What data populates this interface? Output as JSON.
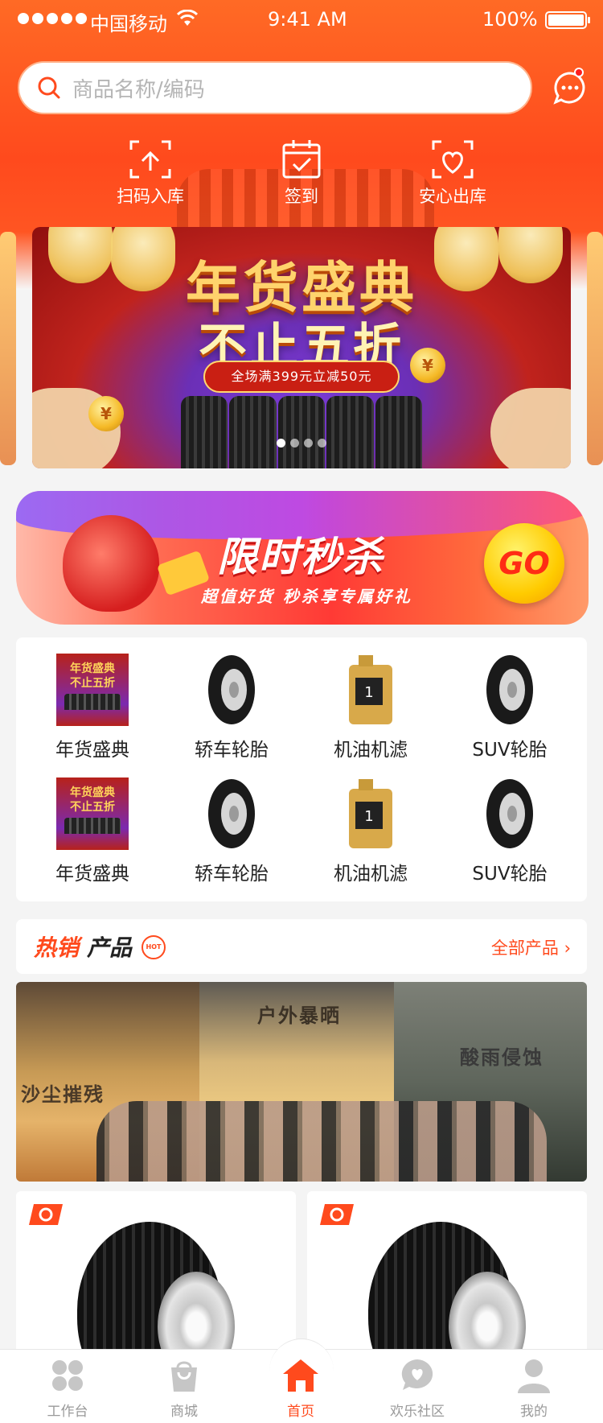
{
  "status_bar": {
    "carrier": "中国移动",
    "time": "9:41 AM",
    "battery": "100%"
  },
  "search": {
    "placeholder": "商品名称/编码"
  },
  "quick_actions": [
    {
      "label": "扫码入库",
      "icon": "scan-in-icon"
    },
    {
      "label": "签到",
      "icon": "calendar-check-icon"
    },
    {
      "label": "安心出库",
      "icon": "scan-out-icon"
    }
  ],
  "banner": {
    "title_line1": "年货盛典",
    "title_line2": "不止五折",
    "promo": "全场满399元立减50元",
    "slides": 4,
    "active_slide": 1
  },
  "flash_sale": {
    "title": "限时秒杀",
    "subtitle": "超值好货 秒杀享专属好礼",
    "go": "GO"
  },
  "categories": [
    {
      "label": "年货盛典",
      "thumb": "promo",
      "thumb_line1": "年货盛典",
      "thumb_line2": "不止五折"
    },
    {
      "label": "轿车轮胎",
      "thumb": "tyre"
    },
    {
      "label": "机油机滤",
      "thumb": "oil"
    },
    {
      "label": "SUV轮胎",
      "thumb": "tyre"
    },
    {
      "label": "年货盛典",
      "thumb": "promo",
      "thumb_line1": "年货盛典",
      "thumb_line2": "不止五折"
    },
    {
      "label": "轿车轮胎",
      "thumb": "tyre"
    },
    {
      "label": "机油机滤",
      "thumb": "oil"
    },
    {
      "label": "SUV轮胎",
      "thumb": "tyre"
    }
  ],
  "hot": {
    "title_red": "热销",
    "title_dark": "产品",
    "badge": "HOT",
    "all_link": "全部产品"
  },
  "feature": {
    "panel1": "沙尘摧残",
    "panel2": "户外暴晒",
    "panel3": "酸雨侵蚀"
  },
  "tabbar": [
    {
      "label": "工作台",
      "icon": "workbench-icon",
      "active": false
    },
    {
      "label": "商城",
      "icon": "shopping-bag-icon",
      "active": false
    },
    {
      "label": "首页",
      "icon": "home-icon",
      "active": true
    },
    {
      "label": "欢乐社区",
      "icon": "chat-heart-icon",
      "active": false
    },
    {
      "label": "我的",
      "icon": "user-icon",
      "active": false
    }
  ],
  "colors": {
    "accent": "#ff4a1d",
    "tab_inactive": "#9a9a9a"
  }
}
